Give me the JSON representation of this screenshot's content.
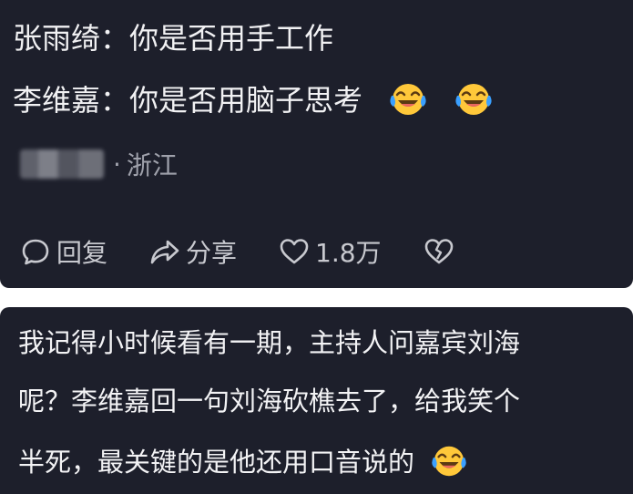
{
  "comment_top": {
    "line1": {
      "speaker": "张雨绮",
      "separator": "：",
      "text": "你是否用手工作"
    },
    "line2": {
      "speaker": "李维嘉",
      "separator": "：",
      "text": "你是否用脑子思考"
    },
    "emoji": "laughing-tears-emoji",
    "meta": {
      "dot": "·",
      "location": "浙江"
    },
    "actions": {
      "reply": "回复",
      "share": "分享",
      "likes": "1.8万"
    }
  },
  "comment_bottom": {
    "line1": "我记得小时候看有一期，主持人问嘉宾刘海",
    "line2": "呢？李维嘉回一句刘海砍樵去了，给我笑个",
    "line3": "半死，最关键的是他还用口音说的"
  },
  "colors": {
    "panel_bg": "#1d1f2b",
    "text": "#f1f1f3",
    "muted": "#9fa1ab",
    "emoji_face": "#ffc83a",
    "emoji_tears": "#3aa0ff"
  },
  "icons": [
    "comment-bubble-icon",
    "share-arrow-icon",
    "heart-icon",
    "broken-heart-icon"
  ]
}
